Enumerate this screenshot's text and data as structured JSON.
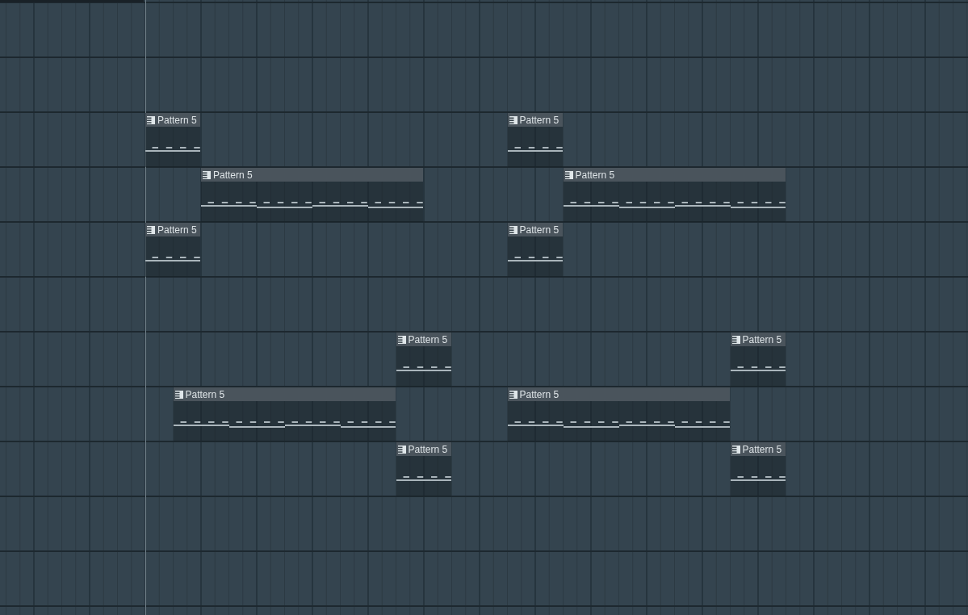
{
  "playlist": {
    "clips": [
      {
        "name": "Pattern 5"
      },
      {
        "name": "Pattern 5"
      },
      {
        "name": "Pattern 5"
      },
      {
        "name": "Pattern 5"
      },
      {
        "name": "Pattern 5"
      },
      {
        "name": "Pattern 5"
      },
      {
        "name": "Pattern 5"
      },
      {
        "name": "Pattern 5"
      },
      {
        "name": "Pattern 5"
      },
      {
        "name": "Pattern 5"
      },
      {
        "name": "Pattern 5"
      },
      {
        "name": "Pattern 5"
      }
    ]
  }
}
